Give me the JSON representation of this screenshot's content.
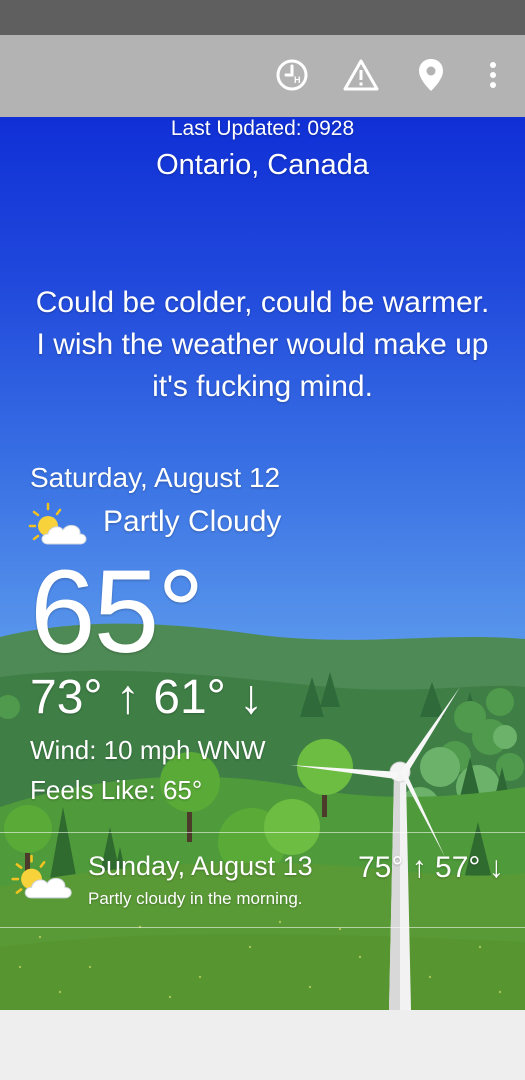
{
  "toolbar": {
    "icons": [
      "hourly-clock-icon",
      "warning-icon",
      "location-pin-icon",
      "more-vert-icon"
    ]
  },
  "header": {
    "last_updated": "Last Updated: 0928",
    "location": "Ontario, Canada"
  },
  "quote": "Could be colder, could be warmer. I wish the weather would make up it's fucking mind.",
  "current": {
    "day": "Saturday, August 12",
    "condition": "Partly Cloudy",
    "condition_icon": "partly-cloudy-icon",
    "temperature": "65°",
    "hilo": "73° ↑ 61° ↓",
    "wind": "Wind: 10 mph WNW",
    "feels_like": "Feels Like: 65°"
  },
  "forecast": [
    {
      "day": "Sunday, August 13",
      "description": "Partly cloudy in the morning.",
      "hilo": "75° ↑ 57° ↓",
      "icon": "partly-cloudy-icon"
    }
  ],
  "colors": {
    "sky_top": "#1030d6",
    "sky_bottom": "#76b2ef",
    "grass": "#5a9a36",
    "toolbar": "#b3b3b3",
    "status_bar": "#5f5f5f"
  }
}
